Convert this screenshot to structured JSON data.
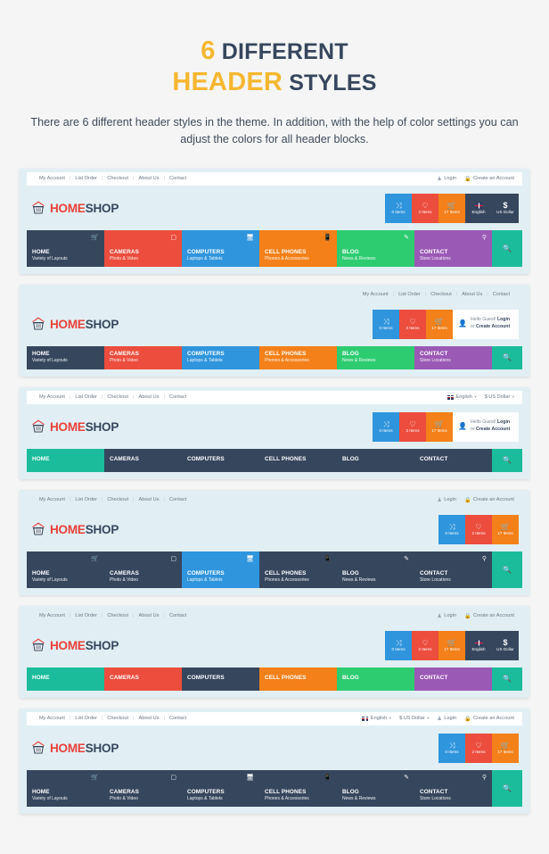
{
  "intro": {
    "title_line1_num": "6",
    "title_line1_rest": "DIFFERENT",
    "title_line2_a": "HEADER",
    "title_line2_b": "STYLES",
    "subtitle": "There are 6 different header styles in the theme. In addition, with the help of color settings you can adjust the colors for all header blocks."
  },
  "brand": {
    "part1": "HOME",
    "part2": "SHOP",
    "logo_icon": "house-basket-icon"
  },
  "topbar_links": [
    "My Account",
    "List Order",
    "Checkout",
    "About Us",
    "Contact"
  ],
  "account_links": {
    "login": "Login",
    "create": "Create an Account"
  },
  "locale": {
    "language": "English",
    "currency": "$ US Dollar",
    "caret": "▾",
    "flag_icon": "uk-flag-icon"
  },
  "greeting": {
    "line1_plain": "Hello Guest! ",
    "line1_bold": "Login",
    "line1_tail": " or",
    "line2": "Create Account",
    "icon": "user-icon"
  },
  "actions": [
    {
      "name": "compare",
      "icon": "compare-icon",
      "glyph": "⇄",
      "label": "0 Items",
      "color": "#2f95dd"
    },
    {
      "name": "wishlist",
      "icon": "heart-icon",
      "glyph": "♡",
      "label": "2 Items",
      "color": "#ec4d3d"
    },
    {
      "name": "cart",
      "icon": "cart-icon",
      "glyph": "🛒",
      "label": "17 Items",
      "color": "#f48019"
    },
    {
      "name": "language",
      "icon": "uk-flag-icon",
      "glyph": "",
      "label": "English",
      "color": "#36465d"
    },
    {
      "name": "currency",
      "icon": "dollar-icon",
      "glyph": "$",
      "label": "US Dollar",
      "color": "#36465d"
    }
  ],
  "nav_items": [
    {
      "title": "HOME",
      "sub": "Variety of Layouts",
      "icon": "basket-icon"
    },
    {
      "title": "CAMERAS",
      "sub": "Photo & Video",
      "icon": "camera-icon"
    },
    {
      "title": "COMPUTERS",
      "sub": "Laptops & Tablets",
      "icon": "monitor-icon"
    },
    {
      "title": "CELL PHONES",
      "sub": "Phones & Accessories",
      "icon": "mobile-icon"
    },
    {
      "title": "BLOG",
      "sub": "News & Reviews",
      "icon": "pencil-icon"
    },
    {
      "title": "CONTACT",
      "sub": "Store Locations",
      "icon": "map-pin-icon"
    }
  ],
  "search": {
    "icon": "search-icon",
    "label": "Search"
  },
  "palette": {
    "dark": "#36465d",
    "red": "#ec4d3d",
    "blue": "#2f95dd",
    "orange": "#f48019",
    "green": "#2ecc71",
    "purple": "#9b59b6",
    "teal": "#1bbc9b",
    "card_bg": "#e1eff4",
    "page_bg": "#f5f5f5",
    "accent_yellow": "#f5b731"
  },
  "headers": [
    {
      "id": 1,
      "style": "colored-nav-with-icons",
      "topbar": "white-left",
      "nav_colors": [
        "dark",
        "red",
        "blue",
        "orange",
        "green",
        "purple"
      ],
      "actions_shown": [
        "compare",
        "wishlist",
        "cart",
        "language",
        "currency"
      ],
      "greeting_shown": false
    },
    {
      "id": 2,
      "style": "colored-nav-no-icons",
      "topbar": "plain-right",
      "nav_colors": [
        "dark",
        "red",
        "blue",
        "orange",
        "green",
        "purple"
      ],
      "actions_shown": [
        "compare",
        "wishlist",
        "cart"
      ],
      "greeting_shown": true
    },
    {
      "id": 3,
      "style": "dark-nav-first-active",
      "topbar": "white-split-locale",
      "nav_colors": [
        "teal",
        "dark",
        "dark",
        "dark",
        "dark",
        "dark"
      ],
      "actions_shown": [
        "compare",
        "wishlist",
        "cart"
      ],
      "greeting_shown": true
    },
    {
      "id": 4,
      "style": "dark-nav-icons-computers-active",
      "topbar": "plain-split",
      "nav_colors": [
        "dark",
        "dark",
        "blue",
        "dark",
        "dark",
        "dark"
      ],
      "actions_shown": [
        "compare",
        "wishlist",
        "cart"
      ],
      "greeting_shown": false
    },
    {
      "id": 5,
      "style": "colored-nav-computers-dark",
      "topbar": "plain-split",
      "nav_colors": [
        "teal",
        "red",
        "dark",
        "orange",
        "green",
        "purple"
      ],
      "actions_shown": [
        "compare",
        "wishlist",
        "cart",
        "language",
        "currency"
      ],
      "greeting_shown": false
    },
    {
      "id": 6,
      "style": "all-dark-nav-icons",
      "topbar": "white-locale-account",
      "nav_colors": [
        "dark",
        "dark",
        "dark",
        "dark",
        "dark",
        "dark"
      ],
      "actions_shown": [
        "compare",
        "wishlist",
        "cart"
      ],
      "greeting_shown": false
    }
  ]
}
